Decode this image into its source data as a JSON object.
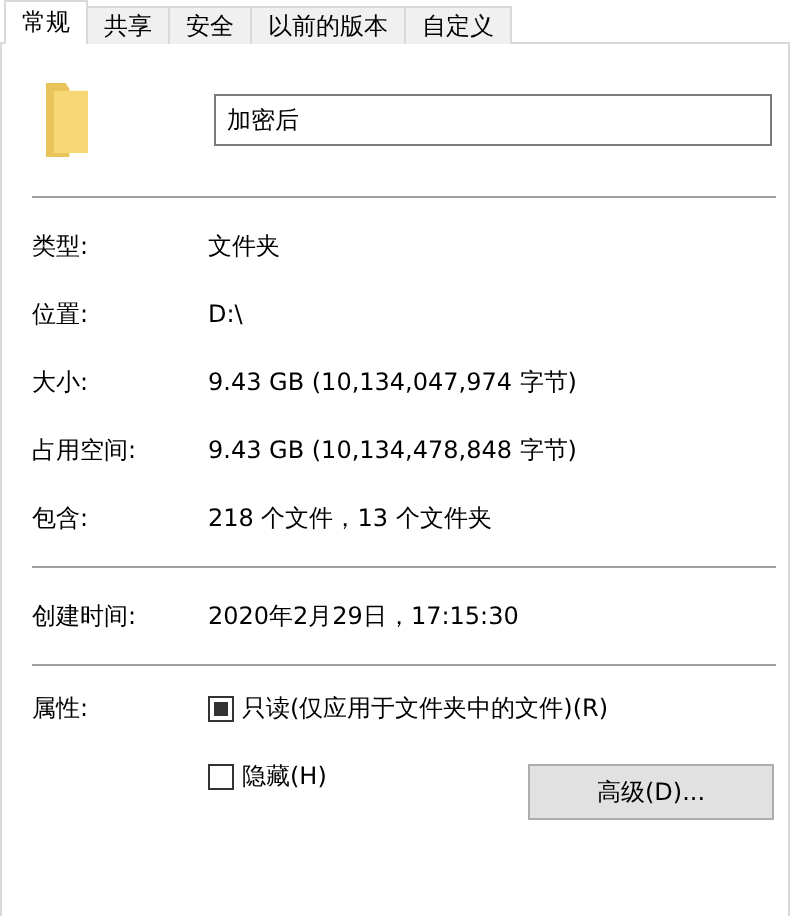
{
  "tabs": [
    {
      "label": "常规",
      "selected": true
    },
    {
      "label": "共享",
      "selected": false
    },
    {
      "label": "安全",
      "selected": false
    },
    {
      "label": "以前的版本",
      "selected": false
    },
    {
      "label": "自定义",
      "selected": false
    }
  ],
  "name_field": {
    "value": "加密后"
  },
  "sections": [
    {
      "rows": [
        {
          "label": "类型:",
          "value": "文件夹"
        },
        {
          "label": "位置:",
          "value": "D:\\"
        },
        {
          "label": "大小:",
          "value": "9.43 GB (10,134,047,974 字节)"
        },
        {
          "label": "占用空间:",
          "value": "9.43 GB (10,134,478,848 字节)"
        },
        {
          "label": "包含:",
          "value": "218 个文件，13 个文件夹"
        }
      ]
    },
    {
      "rows": [
        {
          "label": "创建时间:",
          "value": "2020年2月29日，17:15:30"
        }
      ]
    }
  ],
  "attributes": {
    "label": "属性:",
    "checkboxes": [
      {
        "label": "只读(仅应用于文件夹中的文件)(R)",
        "checked": false,
        "indeterminate": true
      },
      {
        "label": "隐藏(H)",
        "checked": false,
        "indeterminate": false
      }
    ],
    "button": "高级(D)..."
  }
}
